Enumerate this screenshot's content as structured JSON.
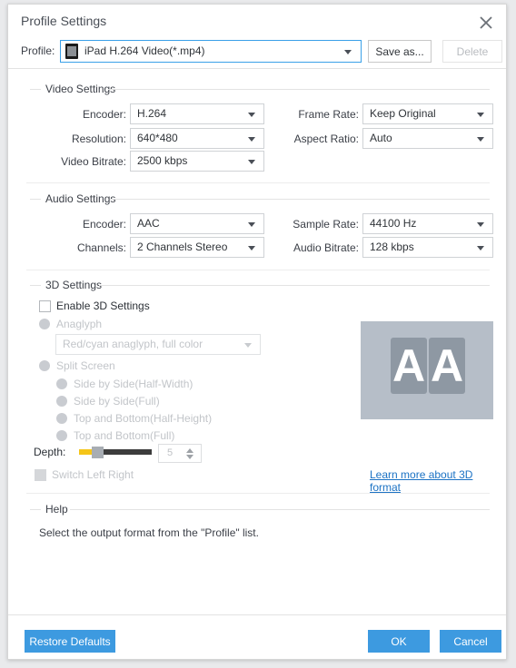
{
  "window": {
    "title": "Profile Settings",
    "close_icon": "close-icon"
  },
  "profile": {
    "label": "Profile:",
    "value": "iPad H.264 Video(*.mp4)",
    "icon": "ipad-device-icon",
    "save_as_label": "Save as...",
    "delete_label": "Delete"
  },
  "video_settings": {
    "title": "Video Settings",
    "fields": [
      {
        "label": "Encoder:",
        "value": "H.264"
      },
      {
        "label": "Resolution:",
        "value": "640*480"
      },
      {
        "label": "Video Bitrate:",
        "value": "2500 kbps"
      },
      {
        "label": "Frame Rate:",
        "value": "Keep Original"
      },
      {
        "label": "Aspect Ratio:",
        "value": "Auto"
      }
    ]
  },
  "audio_settings": {
    "title": "Audio Settings",
    "fields": [
      {
        "label": "Encoder:",
        "value": "AAC"
      },
      {
        "label": "Channels:",
        "value": "2 Channels Stereo"
      },
      {
        "label": "Sample Rate:",
        "value": "44100 Hz"
      },
      {
        "label": "Audio Bitrate:",
        "value": "128 kbps"
      }
    ]
  },
  "three_d_settings": {
    "title": "3D Settings",
    "enable_label": "Enable 3D Settings",
    "enable_checked": false,
    "anaglyph_label": "Anaglyph",
    "anaglyph_value": "Red/cyan anaglyph, full color",
    "split_screen_label": "Split Screen",
    "split_options": [
      "Side by Side(Half-Width)",
      "Side by Side(Full)",
      "Top and Bottom(Half-Height)",
      "Top and Bottom(Full)"
    ],
    "depth_label": "Depth:",
    "depth_value": "5",
    "switch_left_right_label": "Switch Left Right",
    "preview_letter_left": "A",
    "preview_letter_right": "A",
    "learn_more_label": "Learn more about 3D format"
  },
  "help": {
    "title": "Help",
    "text": "Select the output format from the \"Profile\" list."
  },
  "footer": {
    "restore_label": "Restore Defaults",
    "ok_label": "OK",
    "cancel_label": "Cancel"
  },
  "colors": {
    "accent": "#3d9ae0",
    "link": "#1b72c4",
    "slider_fill": "#f5c518",
    "focus_border": "#3aa0e8"
  }
}
